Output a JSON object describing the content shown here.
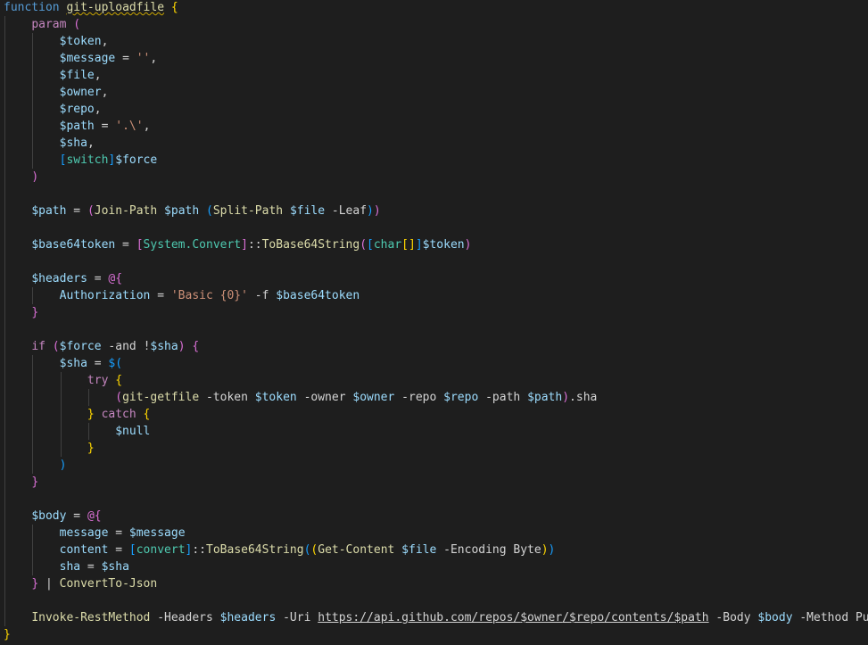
{
  "editor": {
    "language": "powershell",
    "theme": "dark",
    "line_height_px": 19,
    "lines": [
      [
        [
          "function ",
          "kwb"
        ],
        [
          "git-uploadfile",
          "fn squiggle"
        ],
        [
          " ",
          "op"
        ],
        [
          "{",
          "b1"
        ]
      ],
      [
        [
          "    ",
          "op"
        ],
        [
          "param",
          "kw"
        ],
        [
          " ",
          "op"
        ],
        [
          "(",
          "b2"
        ]
      ],
      [
        [
          "        ",
          "op"
        ],
        [
          "$token",
          "var"
        ],
        [
          ",",
          "op"
        ]
      ],
      [
        [
          "        ",
          "op"
        ],
        [
          "$message",
          "var"
        ],
        [
          " = ",
          "op"
        ],
        [
          "''",
          "str"
        ],
        [
          ",",
          "op"
        ]
      ],
      [
        [
          "        ",
          "op"
        ],
        [
          "$file",
          "var"
        ],
        [
          ",",
          "op"
        ]
      ],
      [
        [
          "        ",
          "op"
        ],
        [
          "$owner",
          "var"
        ],
        [
          ",",
          "op"
        ]
      ],
      [
        [
          "        ",
          "op"
        ],
        [
          "$repo",
          "var"
        ],
        [
          ",",
          "op"
        ]
      ],
      [
        [
          "        ",
          "op"
        ],
        [
          "$path",
          "var"
        ],
        [
          " = ",
          "op"
        ],
        [
          "'.\\'",
          "str"
        ],
        [
          ",",
          "op"
        ]
      ],
      [
        [
          "        ",
          "op"
        ],
        [
          "$sha",
          "var"
        ],
        [
          ",",
          "op"
        ]
      ],
      [
        [
          "        ",
          "op"
        ],
        [
          "[",
          "b3"
        ],
        [
          "switch",
          "type"
        ],
        [
          "]",
          "b3"
        ],
        [
          "$force",
          "var"
        ]
      ],
      [
        [
          "    ",
          "op"
        ],
        [
          ")",
          "b2"
        ]
      ],
      [],
      [
        [
          "    ",
          "op"
        ],
        [
          "$path",
          "var"
        ],
        [
          " = ",
          "op"
        ],
        [
          "(",
          "b2"
        ],
        [
          "Join-Path ",
          "fn"
        ],
        [
          "$path",
          "var"
        ],
        [
          " ",
          "op"
        ],
        [
          "(",
          "b3"
        ],
        [
          "Split-Path ",
          "fn"
        ],
        [
          "$file",
          "var"
        ],
        [
          " -Leaf",
          "plain"
        ],
        [
          ")",
          "b3"
        ],
        [
          ")",
          "b2"
        ]
      ],
      [],
      [
        [
          "    ",
          "op"
        ],
        [
          "$base64token",
          "var"
        ],
        [
          " = ",
          "op"
        ],
        [
          "[",
          "b2"
        ],
        [
          "System.Convert",
          "type"
        ],
        [
          "]",
          "b2"
        ],
        [
          "::",
          "op"
        ],
        [
          "ToBase64String",
          "fn"
        ],
        [
          "(",
          "b2"
        ],
        [
          "[",
          "b3"
        ],
        [
          "char",
          "type"
        ],
        [
          "[]",
          "b1"
        ],
        [
          "]",
          "b3"
        ],
        [
          "$token",
          "var"
        ],
        [
          ")",
          "b2"
        ]
      ],
      [],
      [
        [
          "    ",
          "op"
        ],
        [
          "$headers",
          "var"
        ],
        [
          " = ",
          "op"
        ],
        [
          "@{",
          "b2"
        ]
      ],
      [
        [
          "        ",
          "op"
        ],
        [
          "Authorization",
          "var"
        ],
        [
          " = ",
          "op"
        ],
        [
          "'Basic {0}'",
          "str"
        ],
        [
          " -f ",
          "plain"
        ],
        [
          "$base64token",
          "var"
        ]
      ],
      [
        [
          "    ",
          "op"
        ],
        [
          "}",
          "b2"
        ]
      ],
      [],
      [
        [
          "    ",
          "op"
        ],
        [
          "if",
          "kw"
        ],
        [
          " ",
          "op"
        ],
        [
          "(",
          "b2"
        ],
        [
          "$force",
          "var"
        ],
        [
          " -and ",
          "plain"
        ],
        [
          "!",
          "op"
        ],
        [
          "$sha",
          "var"
        ],
        [
          ")",
          "b2"
        ],
        [
          " ",
          "op"
        ],
        [
          "{",
          "b2"
        ]
      ],
      [
        [
          "        ",
          "op"
        ],
        [
          "$sha",
          "var"
        ],
        [
          " = ",
          "op"
        ],
        [
          "$(",
          "b3"
        ]
      ],
      [
        [
          "            ",
          "op"
        ],
        [
          "try",
          "kw"
        ],
        [
          " ",
          "op"
        ],
        [
          "{",
          "b1"
        ]
      ],
      [
        [
          "                ",
          "op"
        ],
        [
          "(",
          "b2"
        ],
        [
          "git-getfile",
          "fn"
        ],
        [
          " -token ",
          "plain"
        ],
        [
          "$token",
          "var"
        ],
        [
          " -owner ",
          "plain"
        ],
        [
          "$owner",
          "var"
        ],
        [
          " -repo ",
          "plain"
        ],
        [
          "$repo",
          "var"
        ],
        [
          " -path ",
          "plain"
        ],
        [
          "$path",
          "var"
        ],
        [
          ")",
          "b2"
        ],
        [
          ".sha",
          "plain"
        ]
      ],
      [
        [
          "            ",
          "op"
        ],
        [
          "}",
          "b1"
        ],
        [
          " ",
          "op"
        ],
        [
          "catch",
          "kw"
        ],
        [
          " ",
          "op"
        ],
        [
          "{",
          "b1"
        ]
      ],
      [
        [
          "                ",
          "op"
        ],
        [
          "$null",
          "var"
        ]
      ],
      [
        [
          "            ",
          "op"
        ],
        [
          "}",
          "b1"
        ]
      ],
      [
        [
          "        ",
          "op"
        ],
        [
          ")",
          "b3"
        ]
      ],
      [
        [
          "    ",
          "op"
        ],
        [
          "}",
          "b2"
        ]
      ],
      [],
      [
        [
          "    ",
          "op"
        ],
        [
          "$body",
          "var"
        ],
        [
          " = ",
          "op"
        ],
        [
          "@{",
          "b2"
        ]
      ],
      [
        [
          "        ",
          "op"
        ],
        [
          "message",
          "var"
        ],
        [
          " = ",
          "op"
        ],
        [
          "$message",
          "var"
        ]
      ],
      [
        [
          "        ",
          "op"
        ],
        [
          "content",
          "var"
        ],
        [
          " = ",
          "op"
        ],
        [
          "[",
          "b3"
        ],
        [
          "convert",
          "type"
        ],
        [
          "]",
          "b3"
        ],
        [
          "::",
          "op"
        ],
        [
          "ToBase64String",
          "fn"
        ],
        [
          "(",
          "b3"
        ],
        [
          "(",
          "b1"
        ],
        [
          "Get-Content ",
          "fn"
        ],
        [
          "$file",
          "var"
        ],
        [
          " -Encoding Byte",
          "plain"
        ],
        [
          ")",
          "b1"
        ],
        [
          ")",
          "b3"
        ]
      ],
      [
        [
          "        ",
          "op"
        ],
        [
          "sha",
          "var"
        ],
        [
          " = ",
          "op"
        ],
        [
          "$sha",
          "var"
        ]
      ],
      [
        [
          "    ",
          "op"
        ],
        [
          "}",
          "b2"
        ],
        [
          " | ",
          "op"
        ],
        [
          "ConvertTo-Json",
          "fn"
        ]
      ],
      [],
      [
        [
          "    ",
          "op"
        ],
        [
          "Invoke-RestMethod",
          "fn"
        ],
        [
          " -Headers ",
          "plain"
        ],
        [
          "$headers",
          "var"
        ],
        [
          " -Uri ",
          "plain"
        ],
        [
          "https://api.github.com/repos/",
          "url"
        ],
        [
          "$owner",
          "var url"
        ],
        [
          "/",
          "url"
        ],
        [
          "$repo",
          "var url"
        ],
        [
          "/contents/",
          "url"
        ],
        [
          "$path",
          "var url"
        ],
        [
          " -Body ",
          "plain"
        ],
        [
          "$body",
          "var"
        ],
        [
          " -Method Put",
          "plain"
        ]
      ],
      [
        [
          "}",
          "b1"
        ]
      ]
    ]
  }
}
